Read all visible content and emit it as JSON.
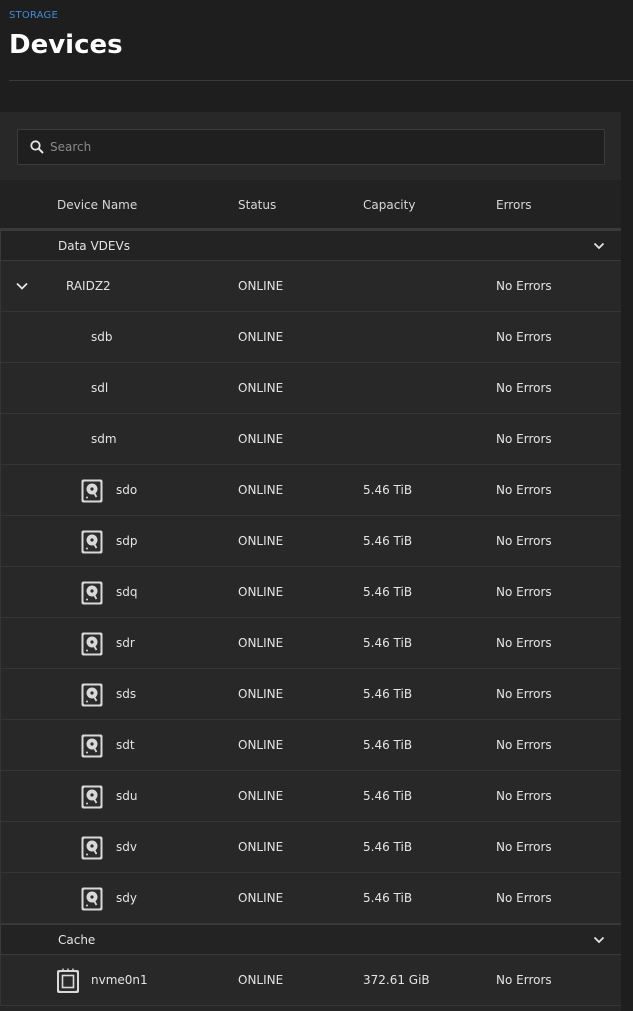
{
  "breadcrumb": "STORAGE",
  "page_title": "Devices",
  "search": {
    "placeholder": "Search",
    "value": ""
  },
  "columns": {
    "device_name": "Device Name",
    "status": "Status",
    "capacity": "Capacity",
    "errors": "Errors"
  },
  "groups": {
    "data": {
      "label": "Data VDEVs",
      "vdev": {
        "name": "RAIDZ2",
        "status": "ONLINE",
        "capacity": "",
        "errors": "No Errors"
      },
      "disks": [
        {
          "name": "sdb",
          "status": "ONLINE",
          "capacity": "",
          "errors": "No Errors",
          "icon": "none"
        },
        {
          "name": "sdl",
          "status": "ONLINE",
          "capacity": "",
          "errors": "No Errors",
          "icon": "none"
        },
        {
          "name": "sdm",
          "status": "ONLINE",
          "capacity": "",
          "errors": "No Errors",
          "icon": "none"
        },
        {
          "name": "sdo",
          "status": "ONLINE",
          "capacity": "5.46 TiB",
          "errors": "No Errors",
          "icon": "hdd-icon"
        },
        {
          "name": "sdp",
          "status": "ONLINE",
          "capacity": "5.46 TiB",
          "errors": "No Errors",
          "icon": "hdd-icon"
        },
        {
          "name": "sdq",
          "status": "ONLINE",
          "capacity": "5.46 TiB",
          "errors": "No Errors",
          "icon": "hdd-icon"
        },
        {
          "name": "sdr",
          "status": "ONLINE",
          "capacity": "5.46 TiB",
          "errors": "No Errors",
          "icon": "hdd-icon"
        },
        {
          "name": "sds",
          "status": "ONLINE",
          "capacity": "5.46 TiB",
          "errors": "No Errors",
          "icon": "hdd-icon"
        },
        {
          "name": "sdt",
          "status": "ONLINE",
          "capacity": "5.46 TiB",
          "errors": "No Errors",
          "icon": "hdd-icon"
        },
        {
          "name": "sdu",
          "status": "ONLINE",
          "capacity": "5.46 TiB",
          "errors": "No Errors",
          "icon": "hdd-icon"
        },
        {
          "name": "sdv",
          "status": "ONLINE",
          "capacity": "5.46 TiB",
          "errors": "No Errors",
          "icon": "hdd-icon"
        },
        {
          "name": "sdy",
          "status": "ONLINE",
          "capacity": "5.46 TiB",
          "errors": "No Errors",
          "icon": "hdd-icon"
        }
      ]
    },
    "cache": {
      "label": "Cache",
      "disks": [
        {
          "name": "nvme0n1",
          "status": "ONLINE",
          "capacity": "372.61 GiB",
          "errors": "No Errors",
          "icon": "ssd-icon"
        }
      ]
    }
  },
  "colors": {
    "accent": "#3f8ed8",
    "background": "#1e1e1e",
    "panel": "#282828"
  }
}
